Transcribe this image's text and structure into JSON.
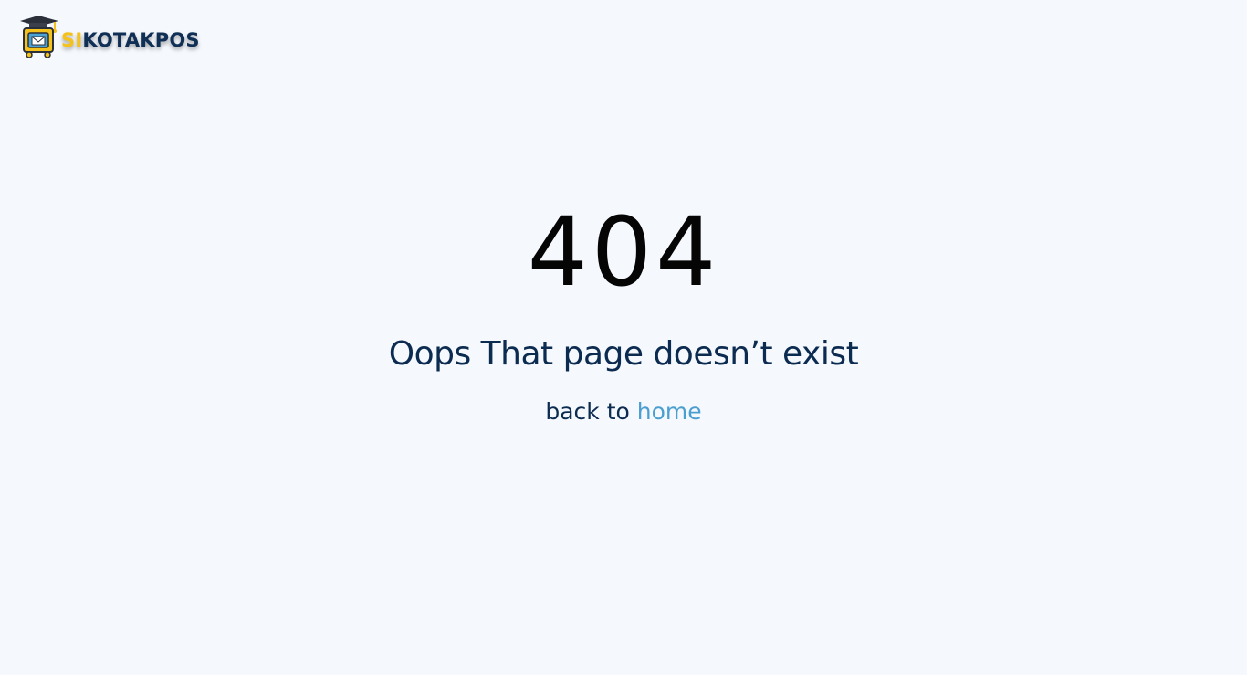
{
  "logo": {
    "prefix": "SI",
    "suffix": "KOTAKPOS",
    "icon": "graduation-mailbox-icon"
  },
  "error": {
    "code": "404",
    "message": "Oops That page doesn’t exist",
    "back_text": "back to",
    "home_link": "home"
  },
  "colors": {
    "background": "#f5f8fd",
    "primary_text": "#0c2b50",
    "link": "#4a9fd0",
    "logo_accent": "#f4c21b"
  }
}
